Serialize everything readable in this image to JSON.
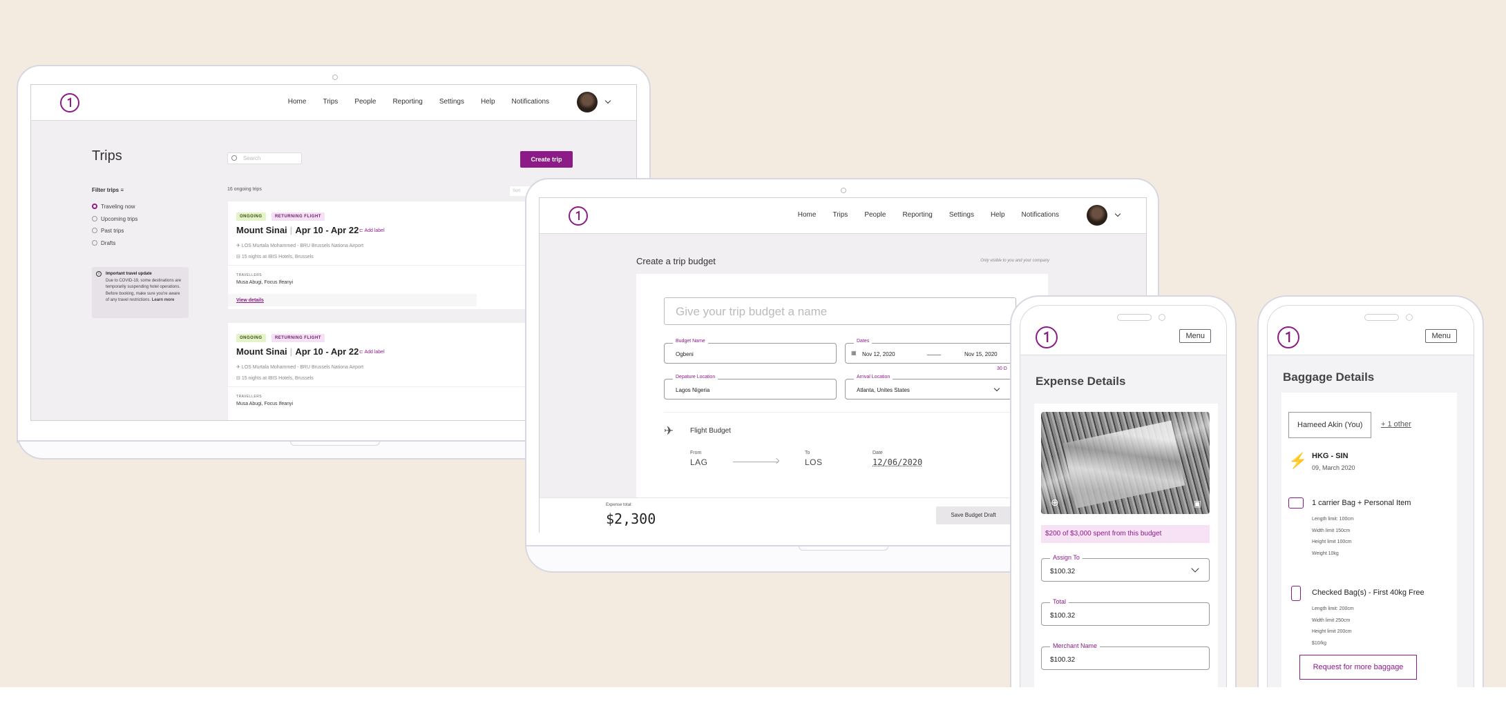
{
  "laptop1": {
    "nav": {
      "items": [
        "Home",
        "Trips",
        "People",
        "Reporting",
        "Settings",
        "Help",
        "Notifications"
      ]
    },
    "page_title": "Trips",
    "search_placeholder": "Search",
    "create_button": "Create trip",
    "ongoing_count": "16 ongoing trips",
    "sort_label": "Sort",
    "filter": {
      "title": "Filter trips",
      "options": [
        "Traveling now",
        "Upcoming trips",
        "Past trips",
        "Drafts"
      ]
    },
    "alert": {
      "title": "Important travel update",
      "body": "Due to COVID-19, some destinations are temporarily suspending hotel operations. Before booking, make sure you're aware of any travel restrictions.",
      "link": "Learn more"
    },
    "trips": [
      {
        "badges": [
          "ONGOING",
          "RETURNING FLIGHT"
        ],
        "name": "Mount Sinai",
        "dates": "Apr 10 - Apr 22",
        "add_label": "Add label",
        "flight": "LOS Murtala Mohammed - BRU Brussels Nationa Airport",
        "hotel": "15 nights at IBIS Hotels, Brussels",
        "travellers_label": "TRAVELLERS",
        "travellers": "Musa Abugi, Focus Ifeanyi",
        "details_link": "View details",
        "price_partial": "$"
      },
      {
        "badges": [
          "ONGOING",
          "RETURNING FLIGHT"
        ],
        "name": "Mount Sinai",
        "dates": "Apr 10 - Apr 22",
        "add_label": "Add label",
        "flight": "LOS Murtala Mohammed - BRU Brussels Nationa Airport",
        "hotel": "15 nights at IBIS Hotels, Brussels",
        "travellers_label": "TRAVELLERS",
        "travellers": "Musa Abugi, Focus Ifeanyi",
        "price_partial": "$"
      }
    ]
  },
  "laptop2": {
    "nav": {
      "items": [
        "Home",
        "Trips",
        "People",
        "Reporting",
        "Settings",
        "Help",
        "Notifications"
      ]
    },
    "title": "Create a trip budget",
    "visibility_note": "Only visible to you and your company",
    "name_placeholder": "Give your trip budget a name",
    "budget_name": {
      "label": "Budget Name",
      "value": "Ogbeni"
    },
    "dates": {
      "label": "Dates",
      "start": "Nov 12, 2020",
      "end": "Nov 15, 2020",
      "duration_partial": "30 D"
    },
    "departure": {
      "label": "Depature Location",
      "value": "Lagos Nigeria"
    },
    "arrival": {
      "label": "Arrival Location",
      "value": "Atlanta, Unites States"
    },
    "flight_budget": {
      "title": "Flight Budget",
      "from_label": "From",
      "from": "LAG",
      "to_label": "To",
      "to": "LOS",
      "date_label": "Date",
      "date": "12/06/2020"
    },
    "expense_label": "Expense total:",
    "expense_total": "$2,300",
    "save_button": "Save Budget Draft"
  },
  "phone1": {
    "menu": "Menu",
    "title": "Expense Details",
    "spent_banner": "$200 of $3,000 spent from this budget",
    "assign": {
      "label": "Assign To",
      "value": "$100.32"
    },
    "total": {
      "label": "Total",
      "value": "$100.32"
    },
    "merchant": {
      "label": "Merchant Name",
      "value": "$100.32"
    }
  },
  "phone2": {
    "menu": "Menu",
    "title": "Baggage Details",
    "traveller": "Hameed Akin (You)",
    "other": "+ 1 other",
    "route": "HKG - SIN",
    "route_date": "09, March 2020",
    "carrier_bag": {
      "title": "1 carrier Bag + Personal Item",
      "lines": [
        "Length limit: 100cm",
        "Width limit 150cm",
        "Height limit 100cm",
        "Weight 10kg"
      ]
    },
    "checked_bag": {
      "title": "Checked Bag(s) - First 40kg Free",
      "lines": [
        "Length limit: 200cm",
        "Width limit 250cm",
        "Height limit 200cm",
        "$10/kg"
      ]
    },
    "request_button": "Request for more baggage"
  },
  "colors": {
    "brand": "#8c1a87",
    "background": "#f3ebe0",
    "notification": "#f3b41c"
  }
}
